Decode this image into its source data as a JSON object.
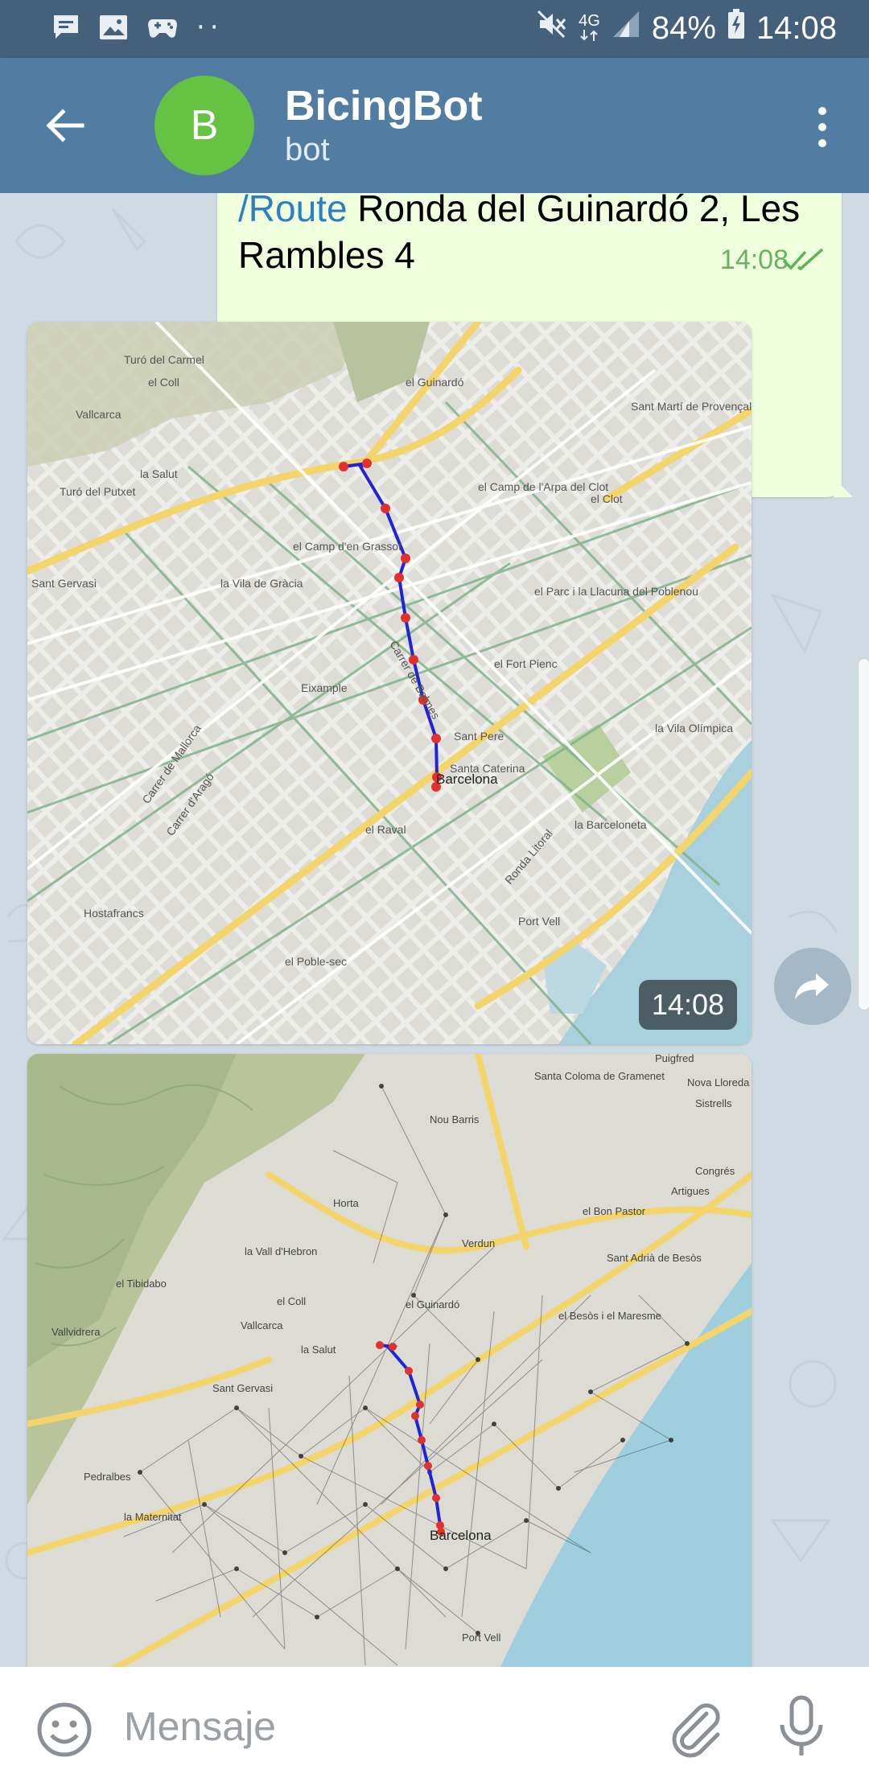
{
  "status_bar": {
    "left_icons": [
      "message-icon",
      "image-icon",
      "game-controller-icon"
    ],
    "more_dots": "··",
    "right_icons": [
      "mute-icon",
      "network-4g-icon",
      "signal-icon",
      "battery-icon"
    ],
    "network": "4G",
    "battery": "84%",
    "time": "14:08"
  },
  "header": {
    "avatar_letter": "B",
    "title": "BicingBot",
    "subtitle": "bot",
    "avatar_color": "#65c242",
    "bar_color": "#527da3"
  },
  "message": {
    "command": "/Route",
    "text": " Ronda del Guinardó 2, Les Rambles 4",
    "time": "14:08",
    "status": "read"
  },
  "photo1": {
    "time": "14:08",
    "map_labels": {
      "barcelona": "Barcelona",
      "guinardo": "el Guinardó",
      "camp_arpa": "el Camp de l'Arpa del Clot",
      "clot": "el Clot",
      "camp_grassot": "el Camp d'en Grassot",
      "vila_gracia": "la Vila de Gràcia",
      "parc_llacuna": "el Parc i la Llacuna del Poblenou",
      "fort_pienc": "el Fort Pienc",
      "eixample": "Eixample",
      "sant_pere": "Sant Pere",
      "santa_caterina": "Santa Caterina",
      "vila_olimpica": "la Vila Olímpica",
      "barceloneta": "la Barceloneta",
      "raval": "el Raval",
      "hostafrancs": "Hostafrancs",
      "poble_sec": "el Poble-sec",
      "port_vell": "Port Vell",
      "carmel": "Turó del Carmel",
      "salut": "la Salut",
      "putxet": "Turó del Putxet",
      "sant_gervasi": "Sant Gervasi",
      "sant_marti": "Sant Martí de Provençals",
      "vallcarca": "Vallcarca",
      "coll": "el Coll",
      "ronda_litoral": "Ronda Litoral",
      "carrer_arago": "Carrer d'Aragó",
      "carrer_mallorca": "Carrer de Mallorca",
      "carrer_balmes": "Carrer de Balmes"
    }
  },
  "photo2": {
    "map_labels": {
      "barcelona": "Barcelona",
      "santa_coloma": "Santa Coloma de Gramenet",
      "nou_barris": "Nou Barris",
      "horta": "Horta",
      "vall_hebron": "la Vall d'Hebron",
      "tibidabo": "el Tibidabo",
      "vallvidrera": "Vallvidrera",
      "vallcarca": "Vallcarca",
      "coll": "el Coll",
      "salut": "la Salut",
      "guinardo": "el Guinardó",
      "bon_pastor": "el Bon Pastor",
      "sant_adria": "Sant Adrià de Besòs",
      "sant_gervasi": "Sant Gervasi",
      "pedralbes": "Pedralbes",
      "maternitat": "la Maternitat",
      "port_vell": "Port Vell",
      "besos": "el Besòs i el Maresme",
      "pugfred": "Puigfred",
      "nova_llore": "Nova Lloreda",
      "sistrells": "Sistrells",
      "congres": "Congrés",
      "artigues": "Artigues",
      "verdun": "Verdun"
    }
  },
  "composer": {
    "placeholder": "Mensaje"
  }
}
